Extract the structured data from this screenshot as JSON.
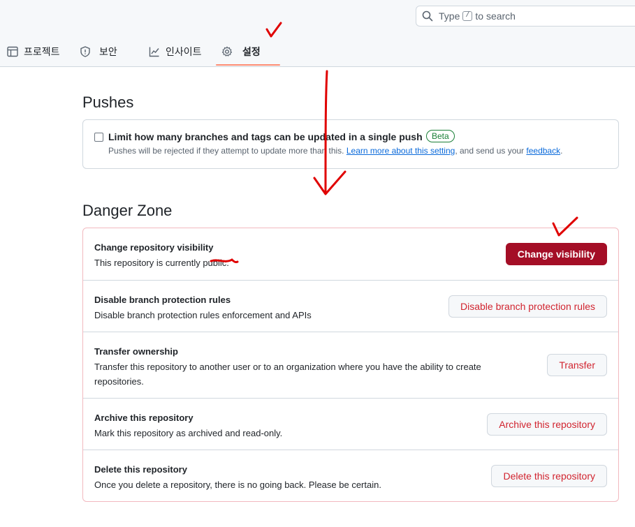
{
  "search": {
    "prefix": "Type",
    "key": "/",
    "suffix": "to search"
  },
  "tabs": [
    {
      "label": "프로젝트",
      "icon": "table-icon"
    },
    {
      "label": "보안",
      "icon": "shield-icon"
    },
    {
      "label": "인사이트",
      "icon": "graph-icon"
    },
    {
      "label": "설정",
      "icon": "gear-icon",
      "active": true
    }
  ],
  "pushes": {
    "title": "Pushes",
    "checkbox_label": "Limit how many branches and tags can be updated in a single push",
    "badge": "Beta",
    "desc_before": "Pushes will be rejected if they attempt to update more than this.",
    "learn_more": "Learn more about this setting",
    "desc_middle": ", and send us your",
    "feedback": "feedback",
    "desc_end": "."
  },
  "danger_zone": {
    "title": "Danger Zone",
    "rows": [
      {
        "title": "Change repository visibility",
        "desc": "This repository is currently public.",
        "button": "Change visibility"
      },
      {
        "title": "Disable branch protection rules",
        "desc": "Disable branch protection rules enforcement and APIs",
        "button": "Disable branch protection rules"
      },
      {
        "title": "Transfer ownership",
        "desc": "Transfer this repository to another user or to an organization where you have the ability to create repositories.",
        "button": "Transfer"
      },
      {
        "title": "Archive this repository",
        "desc": "Mark this repository as archived and read-only.",
        "button": "Archive this repository"
      },
      {
        "title": "Delete this repository",
        "desc": "Once you delete a repository, there is no going back. Please be certain.",
        "button": "Delete this repository"
      }
    ]
  },
  "colors": {
    "danger_button": "#a40e26",
    "annotation": "#e00000",
    "active_tab_underline": "#fd8c73"
  }
}
